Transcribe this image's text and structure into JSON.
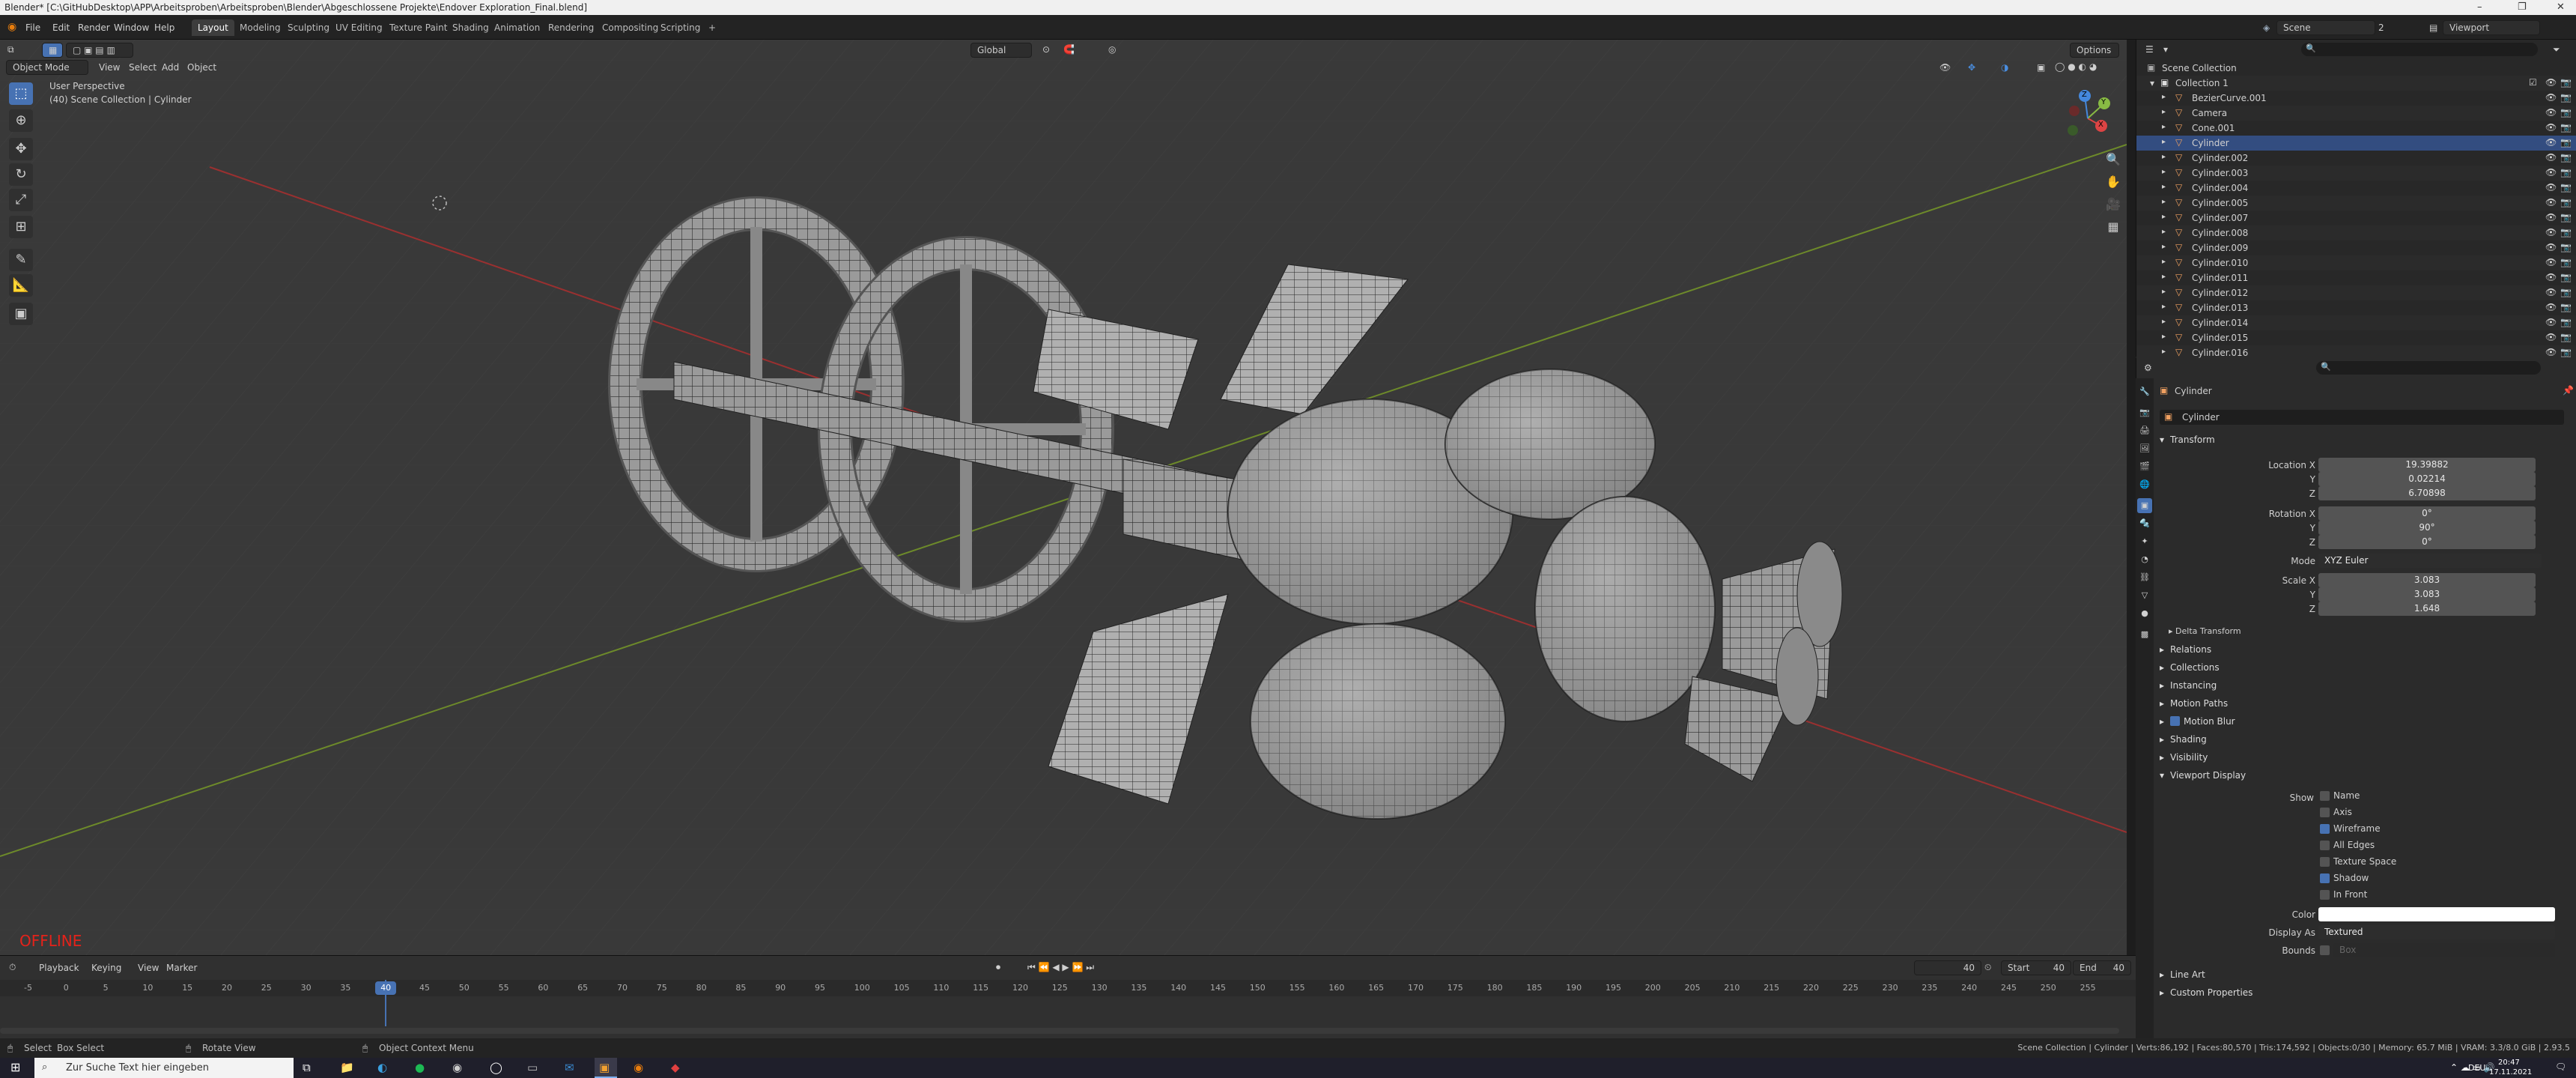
{
  "titlebar": {
    "title": "Blender* [C:\\GitHubDesktop\\APP\\Arbeitsproben\\Arbeitsproben\\Blender\\Abgeschlossene Projekte\\Endover Exploration_Final.blend]"
  },
  "menu": [
    "File",
    "Edit",
    "Render",
    "Window",
    "Help"
  ],
  "workspaces": [
    "Layout",
    "Modeling",
    "Sculpting",
    "UV Editing",
    "Texture Paint",
    "Shading",
    "Animation",
    "Rendering",
    "Compositing",
    "Scripting",
    "+"
  ],
  "scene_name": "Scene",
  "view_layer": "Viewport",
  "scene_count": "2",
  "viewport": {
    "mode": "Object Mode",
    "menus": [
      "View",
      "Select",
      "Add",
      "Object"
    ],
    "orientation": "Global",
    "options": "Options",
    "perspective": "User Perspective",
    "context": "(40) Scene Collection | Cylinder",
    "offline": "OFFLINE",
    "gizmo": {
      "x": "X",
      "y": "Y",
      "z": "Z"
    }
  },
  "outliner": {
    "search_placeholder": "",
    "scene_collection": "Scene Collection",
    "collection": "Collection 1",
    "items": [
      "BezierCurve.001",
      "Camera",
      "Cone.001",
      "Cylinder",
      "Cylinder.002",
      "Cylinder.003",
      "Cylinder.004",
      "Cylinder.005",
      "Cylinder.007",
      "Cylinder.008",
      "Cylinder.009",
      "Cylinder.010",
      "Cylinder.011",
      "Cylinder.012",
      "Cylinder.013",
      "Cylinder.014",
      "Cylinder.015",
      "Cylinder.016"
    ]
  },
  "props": {
    "object_name": "Cylinder",
    "data_name": "Cylinder",
    "transform": "Transform",
    "location": {
      "label": "Location X",
      "y": "Y",
      "z": "Z",
      "x_val": "19.39882",
      "y_val": "0.02214",
      "z_val": "6.70898"
    },
    "rotation": {
      "label": "Rotation X",
      "y": "Y",
      "z": "Z",
      "x_val": "0°",
      "y_val": "90°",
      "z_val": "0°"
    },
    "mode_label": "Mode",
    "mode_val": "XYZ Euler",
    "scale": {
      "label": "Scale X",
      "y": "Y",
      "z": "Z",
      "x_val": "3.083",
      "y_val": "3.083",
      "z_val": "1.648"
    },
    "delta": "Delta Transform",
    "sections": [
      "Relations",
      "Collections",
      "Instancing",
      "Motion Paths",
      "Motion Blur",
      "Shading",
      "Visibility",
      "Viewport Display"
    ],
    "viewport_display": {
      "show": "Show",
      "items": [
        {
          "label": "Name",
          "on": false
        },
        {
          "label": "Axis",
          "on": false
        },
        {
          "label": "Wireframe",
          "on": true
        },
        {
          "label": "All Edges",
          "on": false
        },
        {
          "label": "Texture Space",
          "on": false
        },
        {
          "label": "Shadow",
          "on": true
        },
        {
          "label": "In Front",
          "on": false
        }
      ],
      "color": "Color",
      "display_as": "Display As",
      "display_as_val": "Textured",
      "bounds": "Bounds",
      "bounds_val": "Box"
    },
    "extra": [
      "Line Art",
      "Custom Properties"
    ]
  },
  "timeline": {
    "menus": [
      "Playback",
      "Keying",
      "View",
      "Marker"
    ],
    "current": "40",
    "start_label": "Start",
    "start": "40",
    "end_label": "End",
    "end": "40",
    "ruler": [
      "-5",
      "0",
      "5",
      "10",
      "15",
      "20",
      "25",
      "30",
      "35",
      "40",
      "45",
      "50",
      "55",
      "60",
      "65",
      "70",
      "75",
      "80",
      "85",
      "90",
      "95",
      "100",
      "105",
      "110",
      "115",
      "120",
      "125",
      "130",
      "135",
      "140",
      "145",
      "150",
      "155",
      "160",
      "165",
      "170",
      "175",
      "180",
      "185",
      "190",
      "195",
      "200",
      "205",
      "210",
      "215",
      "220",
      "225",
      "230",
      "235",
      "240",
      "245",
      "250",
      "255"
    ]
  },
  "status": {
    "select": "Select",
    "box_select": "Box Select",
    "rotate": "Rotate View",
    "context_menu": "Object Context Menu",
    "stats": "Scene Collection | Cylinder | Verts:86,192 | Faces:80,570 | Tris:174,592 | Objects:0/30 | Memory: 65.7 MiB | VRAM: 3.3/8.0 GiB | 2.93.5"
  },
  "taskbar": {
    "search_placeholder": "Zur Suche Text hier eingeben",
    "lang": "DEU",
    "time": "20:47",
    "date": "17.11.2021"
  }
}
